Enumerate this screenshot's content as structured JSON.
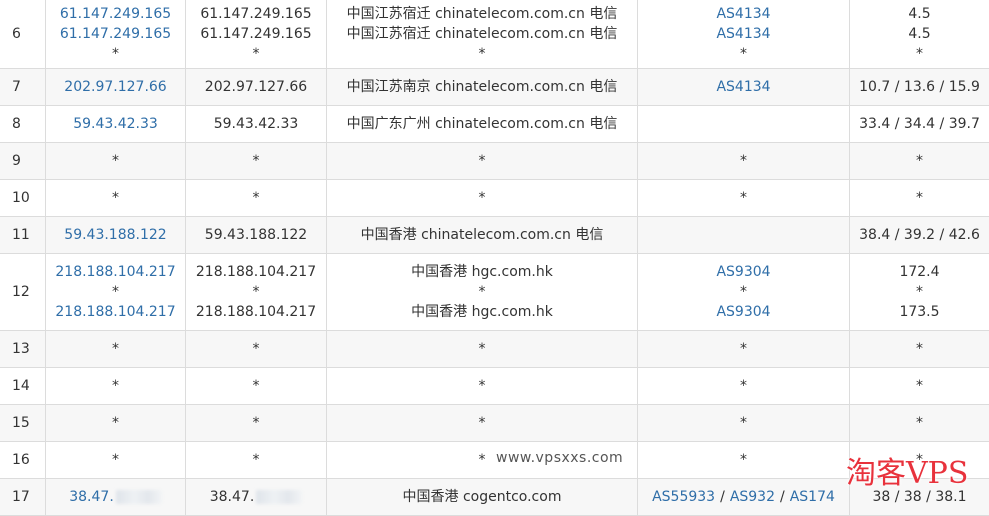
{
  "rows": [
    {
      "hop": "6",
      "ips": [
        "61.147.249.165",
        "61.147.249.165",
        "*"
      ],
      "hosts": [
        "61.147.249.165",
        "61.147.249.165",
        "*"
      ],
      "locs": [
        "中国江苏宿迁 chinatelecom.com.cn 电信",
        "中国江苏宿迁 chinatelecom.com.cn 电信",
        "*"
      ],
      "asns": [
        [
          "AS4134"
        ],
        [
          "AS4134"
        ],
        [
          "*"
        ]
      ],
      "rtts": [
        "4.5",
        "4.5",
        "*"
      ]
    },
    {
      "hop": "7",
      "ips": [
        "202.97.127.66"
      ],
      "hosts": [
        "202.97.127.66"
      ],
      "locs": [
        "中国江苏南京 chinatelecom.com.cn 电信"
      ],
      "asns": [
        [
          "AS4134"
        ]
      ],
      "rtts": [
        "10.7 / 13.6 / 15.9"
      ]
    },
    {
      "hop": "8",
      "ips": [
        "59.43.42.33"
      ],
      "hosts": [
        "59.43.42.33"
      ],
      "locs": [
        "中国广东广州 chinatelecom.com.cn 电信"
      ],
      "asns": [
        []
      ],
      "rtts": [
        "33.4 / 34.4 / 39.7"
      ]
    },
    {
      "hop": "9",
      "ips": [
        "*"
      ],
      "hosts": [
        "*"
      ],
      "locs": [
        "*"
      ],
      "asns": [
        [
          "*"
        ]
      ],
      "rtts": [
        "*"
      ]
    },
    {
      "hop": "10",
      "ips": [
        "*"
      ],
      "hosts": [
        "*"
      ],
      "locs": [
        "*"
      ],
      "asns": [
        [
          "*"
        ]
      ],
      "rtts": [
        "*"
      ]
    },
    {
      "hop": "11",
      "ips": [
        "59.43.188.122"
      ],
      "hosts": [
        "59.43.188.122"
      ],
      "locs": [
        "中国香港 chinatelecom.com.cn 电信"
      ],
      "asns": [
        []
      ],
      "rtts": [
        "38.4 / 39.2 / 42.6"
      ]
    },
    {
      "hop": "12",
      "ips": [
        "218.188.104.217",
        "*",
        "218.188.104.217"
      ],
      "hosts": [
        "218.188.104.217",
        "*",
        "218.188.104.217"
      ],
      "locs": [
        "中国香港 hgc.com.hk",
        "*",
        "中国香港 hgc.com.hk"
      ],
      "asns": [
        [
          "AS9304"
        ],
        [
          "*"
        ],
        [
          "AS9304"
        ]
      ],
      "rtts": [
        "172.4",
        "*",
        "173.5"
      ]
    },
    {
      "hop": "13",
      "ips": [
        "*"
      ],
      "hosts": [
        "*"
      ],
      "locs": [
        "*"
      ],
      "asns": [
        [
          "*"
        ]
      ],
      "rtts": [
        "*"
      ]
    },
    {
      "hop": "14",
      "ips": [
        "*"
      ],
      "hosts": [
        "*"
      ],
      "locs": [
        "*"
      ],
      "asns": [
        [
          "*"
        ]
      ],
      "rtts": [
        "*"
      ]
    },
    {
      "hop": "15",
      "ips": [
        "*"
      ],
      "hosts": [
        "*"
      ],
      "locs": [
        "*"
      ],
      "asns": [
        [
          "*"
        ]
      ],
      "rtts": [
        "*"
      ]
    },
    {
      "hop": "16",
      "ips": [
        "*"
      ],
      "hosts": [
        "*"
      ],
      "locs": [
        "*"
      ],
      "asns": [
        [
          "*"
        ]
      ],
      "rtts": [
        "*"
      ]
    },
    {
      "hop": "17",
      "ips": [
        "38.47."
      ],
      "hosts": [
        "38.47."
      ],
      "locs": [
        "中国香港 cogentco.com"
      ],
      "asns": [
        [
          "AS55933",
          "AS932",
          "AS174"
        ]
      ],
      "rtts": [
        "38 / 38 / 38.1"
      ],
      "redacted": true
    }
  ],
  "watermark": {
    "site": "www.vpsxxs.com",
    "brand": "淘客VPS"
  },
  "colors": {
    "link": "#2f6ea8",
    "border": "#dcdcdc",
    "alt_row": "#f7f7f7",
    "brand": "#e8323c"
  }
}
